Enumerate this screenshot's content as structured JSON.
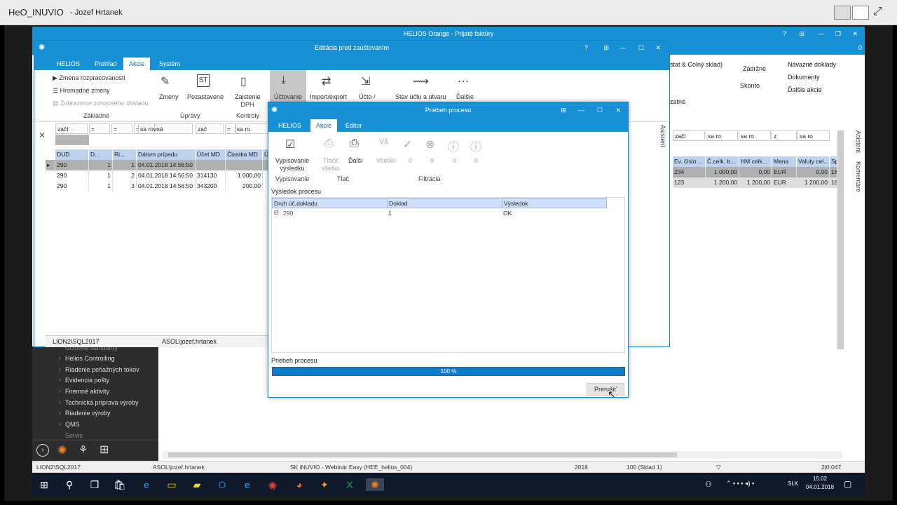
{
  "top": {
    "title": "HeO_INUVIO",
    "user": "- Jozef Hrtanek"
  },
  "helios": {
    "title": "HELIOS Orange - Prijaté faktúry",
    "right_tools": [
      "stat & Colný sklad)",
      "Zádržné",
      "Návazné doklady",
      "Dokumenty",
      "Skonto",
      "Ďalšie akcie",
      "zatné"
    ],
    "side_tabs": [
      "Asistent",
      "Komentáre"
    ],
    "zero": "0"
  },
  "edit": {
    "title": "Editácia pred zaúčtovaním",
    "tabs": [
      "HELIOS",
      "Prehľad",
      "Akcie",
      "Systém"
    ],
    "zakladne": [
      "Zmena rozpracovanosti",
      "Hromadné zmeny",
      "Zobrazenie zdrojového dokladu"
    ],
    "group_zakladne": "Základné",
    "group_upravy": "Úpravy",
    "group_kontroly": "Kontroly",
    "btns": [
      "Zmeny",
      "Pozastavené",
      "Zaistenie DPH",
      "Účtovanie",
      "Import/export",
      "Účto /",
      "Stav účtu a útvaru",
      "Ďalšie"
    ],
    "filter": [
      "začí",
      "=",
      "=",
      "=",
      "sa rovná",
      "zač",
      "=",
      "sa ro"
    ],
    "cols": [
      "DUD",
      "D...",
      "Ri...",
      "Dátum prípadu",
      "Účet MD",
      "Čiastka MD",
      "Ú"
    ],
    "rows": [
      [
        "290",
        "1",
        "1",
        "04.01.2018 14:56:50",
        "",
        ""
      ],
      [
        "290",
        "1",
        "2",
        "04.01.2018 14:56:50",
        "314130",
        "1 000,00"
      ],
      [
        "290",
        "1",
        "3",
        "04.01.2018 14:56:50",
        "343200",
        "200,00"
      ]
    ],
    "status_server": "LION2\\SQL2017",
    "status_user": "ASOL\\jozef.hrtanek",
    "side": "Asistent"
  },
  "proc": {
    "title": "Priebeh procesu",
    "tabs": [
      "HELIOS",
      "Akcie",
      "Editor"
    ],
    "btn_vyp": "Vypisovanie výsledku",
    "btn_tlac_vsetko": "Tlačiť všetko",
    "btn_dalsie": "Ďalší",
    "btn_vsetko": "Všetko",
    "zeros": [
      "0",
      "0",
      "0",
      "0"
    ],
    "group_vyp": "Vypisovanie",
    "group_tlac": "Tlač",
    "group_filt": "Filtrácia",
    "result_label": "Výsledok procesu",
    "cols": [
      "Druh úč.dokladu",
      "Doklad",
      "Výsledok"
    ],
    "rows": [
      [
        "290",
        "1",
        "OK"
      ]
    ],
    "progress_label": "Priebeh procesu",
    "progress_text": "100 %",
    "progress": 1.0,
    "cancel": "Prerušiť"
  },
  "right_grid": {
    "cols": [
      "Ev. číslo ...",
      "Č.celk. b...",
      "HM celk...",
      "Mena",
      "Valuty cel...",
      "Sp"
    ],
    "rows": [
      [
        "234",
        "1 000,00",
        "0,00",
        "EUR",
        "0,00",
        "18"
      ],
      [
        "123",
        "1 200,00",
        "1 200,00",
        "EUR",
        "1 200,00",
        "18"
      ]
    ],
    "filter": [
      "začí",
      "sa ro",
      "sa ro",
      "z",
      "sa ro"
    ]
  },
  "sidebar": {
    "items": [
      "Účtovné štandardy",
      "Helios Controlling",
      "Riadenie peňažných tokov",
      "Evidencia pošty",
      "Firemné aktivity",
      "Technická príprava výroby",
      "Riadenie výroby",
      "QMS",
      "Servis"
    ]
  },
  "status": {
    "server": "LION2\\SQL2017",
    "user": "ASOL\\jozef.hrtanek",
    "db": "SK iNUVIO - Webinár Easy (HEE_helios_004)",
    "year": "2018",
    "sklad": "100 (Sklad 1)",
    "zoom": "2|0:047"
  },
  "taskbar": {
    "lang": "SLK",
    "time": "15:02",
    "date": "04.01.2018"
  }
}
